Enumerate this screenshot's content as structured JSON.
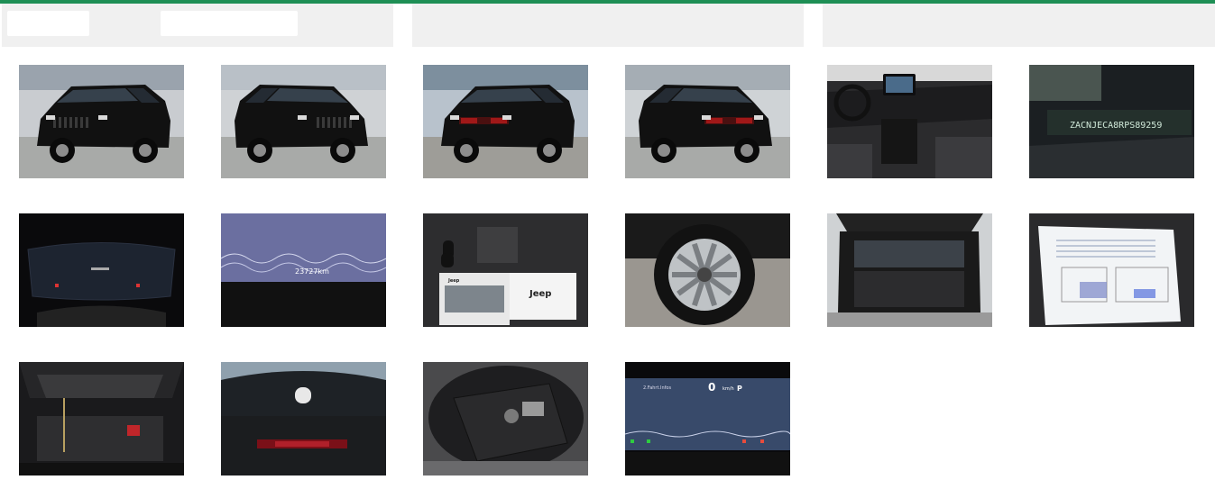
{
  "colors": {
    "accent": "#1e8f55",
    "panel": "#f0f0f0",
    "field": "#ffffff"
  },
  "filters": {
    "panels": [
      {
        "fields": [
          {
            "value": ""
          },
          {
            "value": ""
          }
        ]
      },
      {
        "fields": []
      },
      {
        "fields": []
      }
    ]
  },
  "gallery": {
    "images": [
      {
        "subject": "exterior-front-left"
      },
      {
        "subject": "exterior-front-right"
      },
      {
        "subject": "exterior-rear-right"
      },
      {
        "subject": "exterior-rear-left"
      },
      {
        "subject": "interior-dashboard"
      },
      {
        "subject": "vin-plate",
        "text": "ZACNJECA8RPS89259"
      },
      {
        "subject": "instrument-cluster-dark"
      },
      {
        "subject": "odometer-display",
        "text": "23727km"
      },
      {
        "subject": "keys-and-manuals",
        "text": "Jeep"
      },
      {
        "subject": "wheel-rim"
      },
      {
        "subject": "trunk-open"
      },
      {
        "subject": "service-document"
      },
      {
        "subject": "engine-bay"
      },
      {
        "subject": "windshield-interior"
      },
      {
        "subject": "spare-wheel-well"
      },
      {
        "subject": "instrument-cluster-speed",
        "text": "0",
        "unit": "km/h",
        "gear": "P",
        "label": "2.Fahrt.Infos"
      }
    ]
  }
}
